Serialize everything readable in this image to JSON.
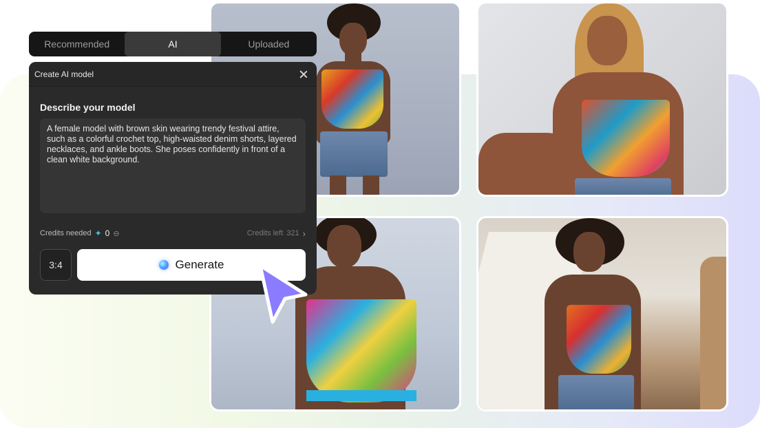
{
  "tabs": [
    {
      "label": "Recommended",
      "active": false
    },
    {
      "label": "AI",
      "active": true
    },
    {
      "label": "Uploaded",
      "active": false
    }
  ],
  "dialog": {
    "title": "Create AI model",
    "section_label": "Describe your model",
    "prompt": "A female model with brown skin wearing trendy festival attire, such as a colorful crochet top, high-waisted denim shorts, layered necklaces, and ankle boots. She poses confidently in front of a clean white background.",
    "credits_needed_label": "Credits needed",
    "credits_needed_value": "0",
    "credits_left_label": "Credits left",
    "credits_left_value": "321",
    "ratio": "3:4",
    "generate_label": "Generate"
  },
  "icons": {
    "close": "close-icon",
    "spark": "sparkle-icon",
    "coin": "coin-icon",
    "chevron": "chevron-right-icon",
    "orb": "orb-icon",
    "cursor": "cursor-arrow-icon"
  },
  "colors": {
    "accent_cursor": "#8b7bff",
    "spark": "#3fc6e0",
    "dialog_bg": "#2a2a2a"
  }
}
